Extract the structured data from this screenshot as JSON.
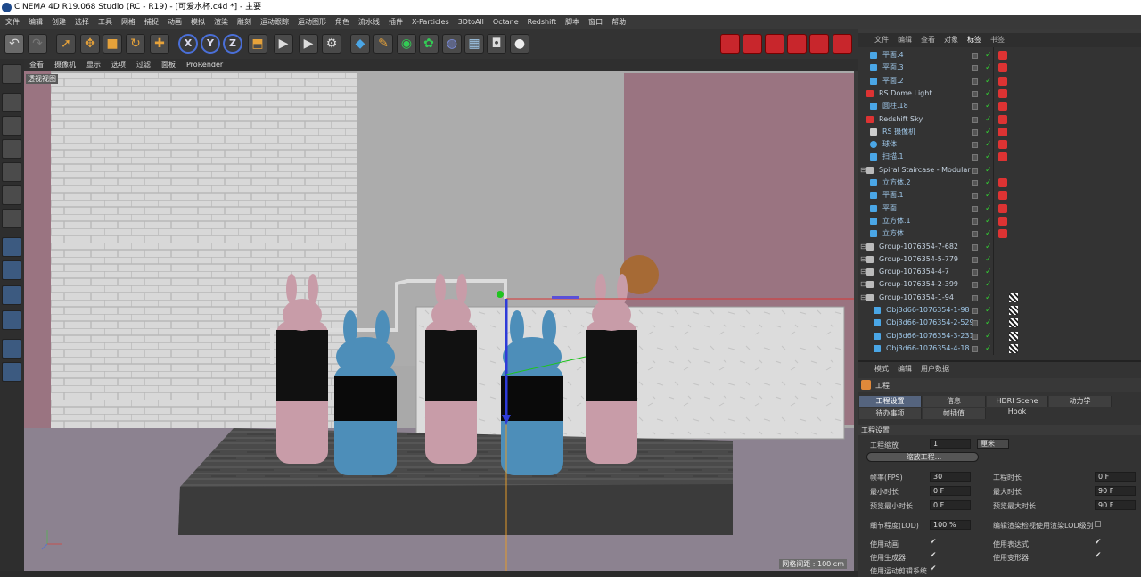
{
  "title": "CINEMA 4D R19.068 Studio (RC - R19) - [可爱水杯.c4d *] - 主要",
  "menu": [
    "文件",
    "编辑",
    "创建",
    "选择",
    "工具",
    "网格",
    "捕捉",
    "动画",
    "模拟",
    "渲染",
    "雕刻",
    "运动跟踪",
    "运动图形",
    "角色",
    "流水线",
    "插件",
    "X-Particles",
    "3DtoAll",
    "Octane",
    "Redshift",
    "脚本",
    "窗口",
    "帮助"
  ],
  "toolbar_icons": [
    "undo-icon",
    "redo-icon",
    "select-icon",
    "move-icon",
    "scale-icon",
    "rotate-icon",
    "transform-icon",
    "x-axis-icon",
    "y-axis-icon",
    "z-axis-icon",
    "coordinate-icon",
    "render-view-icon",
    "render-icon",
    "render-settings-icon",
    "cube-icon",
    "pen-icon",
    "subdivide-icon",
    "cloner-icon",
    "deformer-icon",
    "floor-icon",
    "camera-icon",
    "light-icon"
  ],
  "toolbar_axes": [
    "X",
    "Y",
    "Z"
  ],
  "viewport": {
    "menu": [
      "查看",
      "摄像机",
      "显示",
      "选项",
      "过滤",
      "面板",
      "ProRender"
    ],
    "label": "透视视图",
    "grid_spacing": "网格间距 : 100 cm"
  },
  "object_manager": {
    "tabs": [
      "文件",
      "编辑",
      "查看",
      "对象",
      "标签",
      "书签"
    ],
    "objects": [
      {
        "name": "平面.4",
        "type": "plane",
        "indent": 1
      },
      {
        "name": "平面.3",
        "type": "plane",
        "indent": 1
      },
      {
        "name": "平面.2",
        "type": "plane",
        "indent": 1
      },
      {
        "name": "RS Dome Light",
        "type": "rs",
        "indent": 0
      },
      {
        "name": "圆柱.18",
        "type": "cyl",
        "indent": 1
      },
      {
        "name": "Redshift Sky",
        "type": "rs",
        "indent": 0
      },
      {
        "name": "RS 摄像机",
        "type": "cam",
        "indent": 1
      },
      {
        "name": "球体",
        "type": "sphere",
        "indent": 1
      },
      {
        "name": "扫描.1",
        "type": "sweep",
        "indent": 1
      },
      {
        "name": "Spiral Staircase - Modular",
        "type": "null",
        "indent": 0
      },
      {
        "name": "立方体.2",
        "type": "cube",
        "indent": 1
      },
      {
        "name": "平面.1",
        "type": "plane",
        "indent": 1
      },
      {
        "name": "平面",
        "type": "plane",
        "indent": 1
      },
      {
        "name": "立方体.1",
        "type": "cube",
        "indent": 1
      },
      {
        "name": "立方体",
        "type": "cube",
        "indent": 1
      },
      {
        "name": "Group-1076354-7-682",
        "type": "null",
        "indent": 0
      },
      {
        "name": "Group-1076354-5-779",
        "type": "null",
        "indent": 0
      },
      {
        "name": "Group-1076354-4-7",
        "type": "null",
        "indent": 0
      },
      {
        "name": "Group-1076354-2-399",
        "type": "null",
        "indent": 0
      },
      {
        "name": "Group-1076354-1-94",
        "type": "null",
        "indent": 0
      },
      {
        "name": "Obj3d66-1076354-1-98",
        "type": "poly",
        "indent": 2
      },
      {
        "name": "Obj3d66-1076354-2-529",
        "type": "poly",
        "indent": 2
      },
      {
        "name": "Obj3d66-1076354-3-231",
        "type": "poly",
        "indent": 2
      },
      {
        "name": "Obj3d66-1076354-4-18",
        "type": "poly",
        "indent": 2
      }
    ]
  },
  "attributes": {
    "menu": [
      "模式",
      "编辑",
      "用户数据"
    ],
    "header": "工程",
    "tabs_row1": [
      "工程设置",
      "信息",
      "HDRI Scene Hook",
      "动力学"
    ],
    "tabs_row2": [
      "待办事项",
      "帧插值"
    ],
    "section": "工程设置",
    "scale_label": "工程缩放",
    "scale_value": "1",
    "scale_unit": "厘米",
    "scale_button": "缩放工程...",
    "fps_label": "帧率(FPS)",
    "fps_value": "30",
    "duration_label": "工程时长",
    "duration_value": "0 F",
    "min_label": "最小时长",
    "min_value": "0 F",
    "max_label": "最大时长",
    "max_value": "90 F",
    "pmin_label": "预览最小时长",
    "pmin_value": "0 F",
    "pmax_label": "预览最大时长",
    "pmax_value": "90 F",
    "lod_label": "细节程度(LOD)",
    "lod_value": "100 %",
    "lod_render_label": "编辑渲染检视使用渲染LOD级别",
    "checks": [
      {
        "label": "使用动画",
        "checked": true
      },
      {
        "label": "使用表达式",
        "checked": true
      },
      {
        "label": "使用生成器",
        "checked": true
      },
      {
        "label": "使用变形器",
        "checked": true
      },
      {
        "label": "使用运动剪辑系统",
        "checked": true
      }
    ],
    "check_mark": "✔"
  },
  "colors": {
    "accent": "#2a6fba",
    "active_tab": "#55647e",
    "wall_pink": "#9a7481",
    "bunny_pink": "#c89ca8",
    "bunny_blue": "#4d8eb9"
  }
}
